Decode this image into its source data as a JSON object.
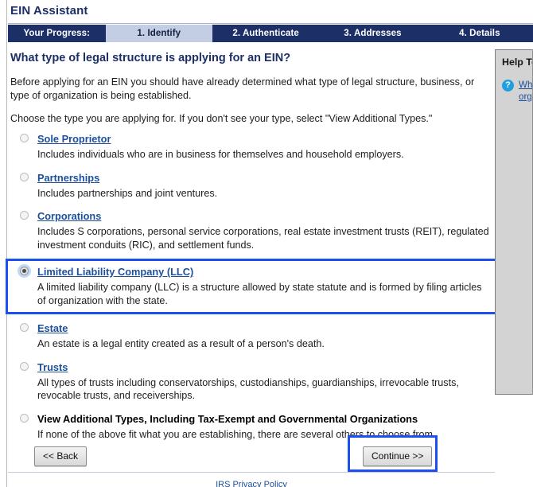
{
  "app": {
    "title": "EIN Assistant"
  },
  "progress": {
    "label": "Your Progress:",
    "steps": [
      {
        "label": "1. Identify",
        "active": true
      },
      {
        "label": "2. Authenticate",
        "active": false
      },
      {
        "label": "3. Addresses",
        "active": false
      },
      {
        "label": "4. Details",
        "active": false
      }
    ]
  },
  "main": {
    "question": "What type of legal structure is applying for an EIN?",
    "paragraph1": "Before applying for an EIN you should have already determined what type of legal structure, business, or type of organization is being established.",
    "paragraph2": "Choose the type you are applying for. If you don't see your type, select \"View Additional Types.\"",
    "options": [
      {
        "label": "Sole Proprietor",
        "description": "Includes individuals who are in business for themselves and household employers.",
        "selected": false,
        "link": true,
        "highlighted": false
      },
      {
        "label": "Partnerships",
        "description": "Includes partnerships and joint ventures.",
        "selected": false,
        "link": true,
        "highlighted": false
      },
      {
        "label": "Corporations",
        "description": "Includes S corporations, personal service corporations, real estate investment trusts (REIT), regulated investment conduits (RIC), and settlement funds.",
        "selected": false,
        "link": true,
        "highlighted": false
      },
      {
        "label": "Limited Liability Company (LLC)",
        "description": "A limited liability company (LLC) is a structure allowed by state statute and is formed by filing articles of organization with the state.",
        "selected": true,
        "link": true,
        "highlighted": true
      },
      {
        "label": "Estate",
        "description": "An estate is a legal entity created as a result of a person's death.",
        "selected": false,
        "link": true,
        "highlighted": false
      },
      {
        "label": "Trusts",
        "description": "All types of trusts including conservatorships, custodianships, guardianships, irrevocable trusts, revocable trusts, and receiverships.",
        "selected": false,
        "link": true,
        "highlighted": false
      },
      {
        "label": "View Additional Types, Including Tax-Exempt and Governmental Organizations",
        "description": "If none of the above fit what you are establishing, there are several others to choose from.",
        "selected": false,
        "link": false,
        "highlighted": false
      }
    ]
  },
  "buttons": {
    "back": "<< Back",
    "continue": "Continue >>"
  },
  "footer": {
    "link": "IRS Privacy Policy"
  },
  "help": {
    "title": "Help To",
    "icon": "question-mark-icon",
    "link": "Wh typ org"
  },
  "colors": {
    "navy": "#1c2f66",
    "active_tab": "#c3cde4",
    "link_blue": "#1d4f9c",
    "annotation_blue": "#1b4ff0",
    "help_panel_bg": "#d3d3d3"
  }
}
